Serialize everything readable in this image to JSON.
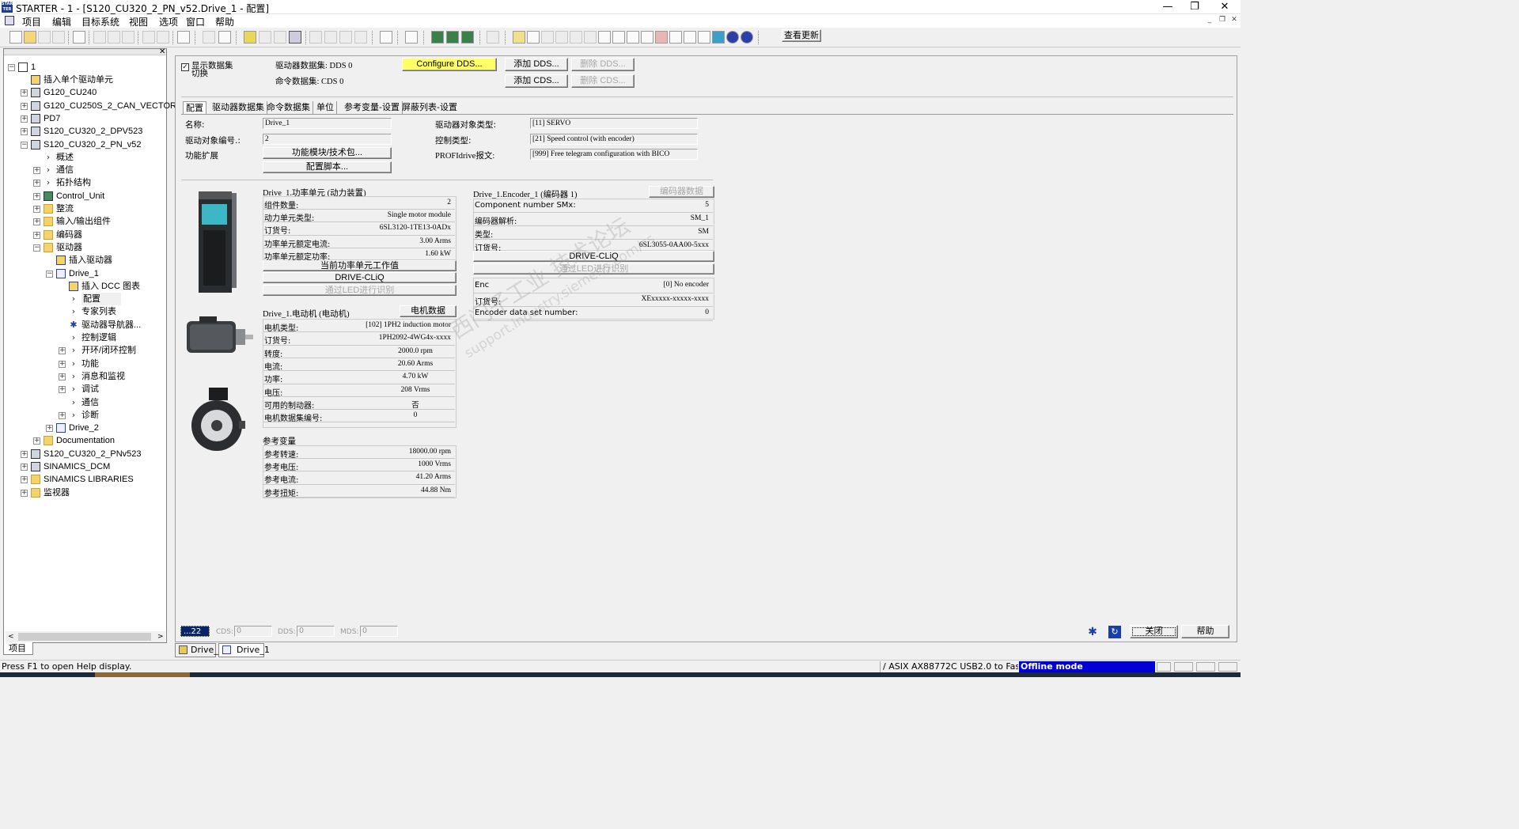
{
  "window": {
    "app_icon_text": "STARTER",
    "title": "STARTER - 1 - [S120_CU320_2_PN_v52.Drive_1 - 配置]",
    "controls": [
      "—",
      "❐",
      "✕"
    ]
  },
  "menu": [
    "项目",
    "编辑",
    "目标系统",
    "视图",
    "选项",
    "窗口",
    "帮助"
  ],
  "toolbar": {
    "update_button": "查看更新"
  },
  "tree": {
    "root": "1",
    "items": [
      {
        "label": "插入单个驱动单元",
        "indent": 1,
        "expand": "",
        "icon": "insert"
      },
      {
        "label": "G120_CU240",
        "indent": 1,
        "expand": "+",
        "icon": "dev"
      },
      {
        "label": "G120_CU250S_2_CAN_VECTOR",
        "indent": 1,
        "expand": "+",
        "icon": "dev"
      },
      {
        "label": "PD7",
        "indent": 1,
        "expand": "+",
        "icon": "dev"
      },
      {
        "label": "S120_CU320_2_DPV523",
        "indent": 1,
        "expand": "+",
        "icon": "dev"
      },
      {
        "label": "S120_CU320_2_PN_v52",
        "indent": 1,
        "expand": "-",
        "icon": "dev"
      },
      {
        "label": "概述",
        "indent": 2,
        "expand": "",
        "icon": "arr"
      },
      {
        "label": "通信",
        "indent": 2,
        "expand": "+",
        "icon": "arr"
      },
      {
        "label": "拓扑结构",
        "indent": 2,
        "expand": "+",
        "icon": "arr"
      },
      {
        "label": "Control_Unit",
        "indent": 2,
        "expand": "+",
        "icon": "cu"
      },
      {
        "label": "整流",
        "indent": 2,
        "expand": "+",
        "icon": "fold"
      },
      {
        "label": "输入/输出组件",
        "indent": 2,
        "expand": "+",
        "icon": "fold"
      },
      {
        "label": "编码器",
        "indent": 2,
        "expand": "+",
        "icon": "fold"
      },
      {
        "label": "驱动器",
        "indent": 2,
        "expand": "-",
        "icon": "fold"
      },
      {
        "label": "插入驱动器",
        "indent": 3,
        "expand": "",
        "icon": "insert"
      },
      {
        "label": "Drive_1",
        "indent": 3,
        "expand": "-",
        "icon": "drive"
      },
      {
        "label": "插入 DCC 图表",
        "indent": 4,
        "expand": "",
        "icon": "insert"
      },
      {
        "label": "配置",
        "indent": 4,
        "expand": "",
        "icon": "arr",
        "selected": true
      },
      {
        "label": "专家列表",
        "indent": 4,
        "expand": "",
        "icon": "arr"
      },
      {
        "label": "驱动器导航器...",
        "indent": 4,
        "expand": "",
        "icon": "gear"
      },
      {
        "label": "控制逻辑",
        "indent": 4,
        "expand": "",
        "icon": "arr"
      },
      {
        "label": "开环/闭环控制",
        "indent": 4,
        "expand": "+",
        "icon": "arr"
      },
      {
        "label": "功能",
        "indent": 4,
        "expand": "+",
        "icon": "arr"
      },
      {
        "label": "消息和监视",
        "indent": 4,
        "expand": "+",
        "icon": "arr"
      },
      {
        "label": "调试",
        "indent": 4,
        "expand": "+",
        "icon": "arr"
      },
      {
        "label": "通信",
        "indent": 4,
        "expand": "",
        "icon": "arr"
      },
      {
        "label": "诊断",
        "indent": 4,
        "expand": "+",
        "icon": "arr"
      },
      {
        "label": "Drive_2",
        "indent": 3,
        "expand": "+",
        "icon": "drive"
      },
      {
        "label": "Documentation",
        "indent": 2,
        "expand": "+",
        "icon": "fold"
      },
      {
        "label": "S120_CU320_2_PNv523",
        "indent": 1,
        "expand": "+",
        "icon": "dev"
      },
      {
        "label": "SINAMICS_DCM",
        "indent": 1,
        "expand": "+",
        "icon": "dev"
      },
      {
        "label": "SINAMICS LIBRARIES",
        "indent": 1,
        "expand": "+",
        "icon": "fold"
      },
      {
        "label": "监视器",
        "indent": 1,
        "expand": "+",
        "icon": "fold"
      }
    ],
    "bottom_tab": "项目"
  },
  "dataset": {
    "show_switch_label_1": "显示数据集",
    "show_switch_label_2": "切换",
    "show_switch_checked": true,
    "dds_label": "驱动器数据集: DDS 0",
    "cds_label": "命令数据集: CDS 0",
    "configure_dds": "Configure DDS...",
    "add_dds": "添加 DDS...",
    "delete_dds": "删除 DDS...",
    "add_cds": "添加 CDS...",
    "delete_cds": "删除 CDS..."
  },
  "tabs": [
    "配置",
    "驱动器数据集",
    "命令数据集",
    "单位",
    "参考变量-设置",
    "屏蔽列表-设置"
  ],
  "config": {
    "name_label": "名称:",
    "name_value": "Drive_1",
    "obj_no_label": "驱动对象编号.:",
    "obj_no_value": "2",
    "func_ext_label": "功能扩展",
    "func_module_button": "功能模块/技术包...",
    "config_script_button": "配置脚本...",
    "obj_type_label": "驱动器对象类型:",
    "obj_type_value": "[11] SERVO",
    "ctrl_type_label": "控制类型:",
    "ctrl_type_value": "[21] Speed control (with encoder)",
    "profidrive_label": "PROFIdrive报文:",
    "profidrive_value": "[999] Free telegram configuration with BICO"
  },
  "power_unit": {
    "title": "Drive_1.功率单元 (动力装置)",
    "rows": [
      {
        "label": "组件数量:",
        "value": "2"
      },
      {
        "label": "动力单元类型:",
        "value": "Single motor module"
      },
      {
        "label": "订货号:",
        "value": "6SL3120-1TE13-0ADx"
      },
      {
        "label": "功率单元额定电流:",
        "value": "3.00 Arms"
      },
      {
        "label": "功率单元额定功率:",
        "value": "1.60 kW"
      }
    ],
    "btn_current_values": "当前功率单元工作值",
    "btn_drive_cliq": "DRIVE-CLiQ",
    "btn_led": "通过LED进行识别"
  },
  "encoder": {
    "title": "Drive_1.Encoder_1 (编码器 1)",
    "data_button": "编码器数据",
    "rows": [
      {
        "label": "Component number SMx:",
        "value": "5"
      },
      {
        "label": "编码器解析:",
        "value": "SM_1"
      },
      {
        "label": "类型:",
        "value": "SM"
      },
      {
        "label": "订货号:",
        "value": "6SL3055-0AA00-5xxx"
      }
    ],
    "btn_drive_cliq": "DRIVE-CLiQ",
    "btn_led": "通过LED进行识别",
    "rows2": [
      {
        "label": "Enc",
        "value": "[0] No encoder"
      },
      {
        "label": "订货号:",
        "value": "XExxxxx-xxxxx-xxxx"
      },
      {
        "label": "Encoder data set number:",
        "value": "0"
      }
    ]
  },
  "motor": {
    "title": "Drive_1.电动机 (电动机)",
    "data_button": "电机数据",
    "rows": [
      {
        "label": "电机类型:",
        "value": "[102] 1PH2 induction motor"
      },
      {
        "label": "订货号:",
        "value": "1PH2092-4WG4x-xxxx"
      },
      {
        "label": "转度:",
        "value": "2000.0 rpm"
      },
      {
        "label": "电流:",
        "value": "20.60 Arms"
      },
      {
        "label": "功率:",
        "value": "4.70 kW"
      },
      {
        "label": "电压:",
        "value": "208 Vrms"
      },
      {
        "label": "可用的制动器:",
        "value": "否"
      },
      {
        "label": "电机数据集编号:",
        "value": "0"
      }
    ]
  },
  "reference": {
    "title": "参考变量",
    "rows": [
      {
        "label": "参考转速:",
        "value": "18000.00 rpm"
      },
      {
        "label": "参考电压:",
        "value": "1000 Vrms"
      },
      {
        "label": "参考电流:",
        "value": "41.20 Arms"
      },
      {
        "label": "参考扭矩:",
        "value": "44.88 Nm"
      }
    ]
  },
  "watermark": {
    "line1": "西门子工业 技术论坛",
    "line2": "support.industry.siemens.com/cs"
  },
  "bottom_bar": {
    "drive_no": "...22",
    "cds_label": "CDS:",
    "cds_value": "0",
    "dds_label": "DDS:",
    "dds_value": "0",
    "mds_label": "MDS:",
    "mds_value": "0",
    "close_button": "关闭",
    "help_button": "帮助"
  },
  "doc_tabs": [
    "Drive_1",
    "Drive_1"
  ],
  "statusbar": {
    "help_text": "Press F1 to open Help display.",
    "adapter": "/ ASIX AX88772C USB2.0 to Fast Eth",
    "mode": "Offline mode"
  },
  "colors": {
    "configure_dds_bg": "#ffff66",
    "offline_bg": "#0000d4",
    "selection_bg": "#0a246a"
  }
}
